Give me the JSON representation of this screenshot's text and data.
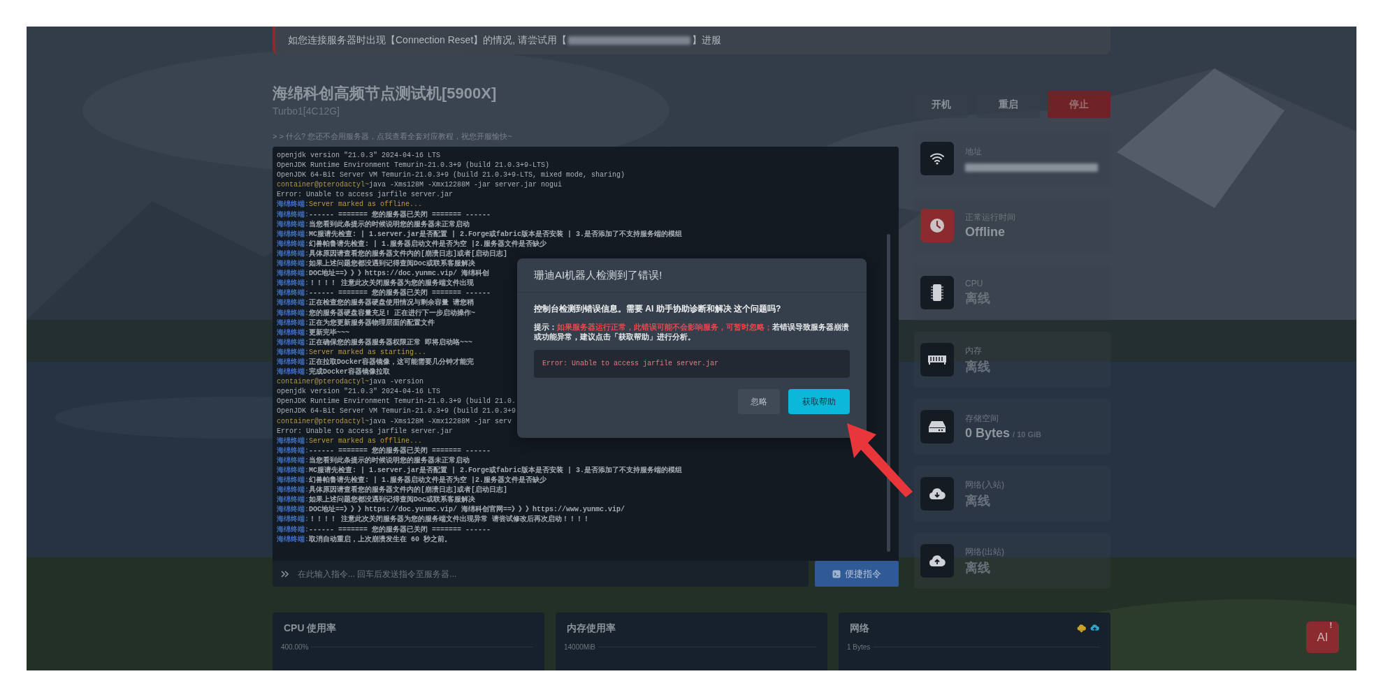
{
  "notice": {
    "before": "如您连接服务器时出现【Connection Reset】的情况, 请尝试用【",
    "after": "】进服",
    "redacted": true
  },
  "server": {
    "title": "海绵科创高频节点测试机[5900X]",
    "subtitle": "Turbo1[4C12G]",
    "hint": "> > 什么? 您还不会用服务器，点我查看全套对应教程，祝您开服愉快~"
  },
  "terminal": {
    "lines": [
      {
        "kind": "output",
        "text": "openjdk version \"21.0.3\" 2024-04-16 LTS"
      },
      {
        "kind": "output",
        "text": "OpenJDK Runtime Environment Temurin-21.0.3+9 (build 21.0.3+9-LTS)"
      },
      {
        "kind": "output",
        "text": "OpenJDK 64-Bit Server VM Temurin-21.0.3+9 (build 21.0.3+9-LTS, mixed mode, sharing)"
      },
      {
        "kind": "prompt",
        "prefix": "container@pterodactyl~",
        "text": "java -Xms128M -Xmx12288M -jar server.jar nogui"
      },
      {
        "kind": "output",
        "text": "Error: Unable to access jarfile server.jar"
      },
      {
        "kind": "status",
        "prefix": "海绵终端:",
        "text": "Server marked as offline..."
      },
      {
        "kind": "daemon",
        "prefix": "海绵终端:",
        "text": "------ ======= 您的服务器已关闭 ======= ------"
      },
      {
        "kind": "daemon",
        "prefix": "海绵终端:",
        "text": "当您看到此条提示的时候说明您的服务器未正常启动"
      },
      {
        "kind": "daemon",
        "prefix": "海绵终端:",
        "text": "MC服请先检查: | 1.server.jar是否配置 | 2.Forge或fabric版本是否安装 | 3.是否添加了不支持服务端的模组"
      },
      {
        "kind": "daemon",
        "prefix": "海绵终端:",
        "text": "幻兽帕鲁请先检查: | 1.服务器启动文件是否为空 |2.服务器文件是否缺少"
      },
      {
        "kind": "daemon",
        "prefix": "海绵终端:",
        "text": "具体原因请查看您的服务器文件内的[崩溃日志]或者[启动日志]"
      },
      {
        "kind": "daemon",
        "prefix": "海绵终端:",
        "text": "如果上述问题您都没遇到记得查阅Doc或联系客服解决"
      },
      {
        "kind": "daemon",
        "prefix": "海绵终端:",
        "text": "DOC地址==》》》https://doc.yunmc.vip/ 海绵科创"
      },
      {
        "kind": "daemon",
        "prefix": "海绵终端:",
        "text": "！！！！ 注意此次关闭服务器为您的服务端文件出现"
      },
      {
        "kind": "daemon",
        "prefix": "海绵终端:",
        "text": "------ ======= 您的服务器已关闭 ======= ------"
      },
      {
        "kind": "daemon",
        "prefix": "海绵终端:",
        "text": "正在检查您的服务器硬盘使用情况与剩余容量 请您稍"
      },
      {
        "kind": "daemon",
        "prefix": "海绵终端:",
        "text": "您的服务器硬盘容量充足! 正在进行下一步启动操作~"
      },
      {
        "kind": "daemon",
        "prefix": "海绵终端:",
        "text": "正在为您更新服务器物理层面的配置文件"
      },
      {
        "kind": "daemon",
        "prefix": "海绵终端:",
        "text": "更新完毕~~~"
      },
      {
        "kind": "daemon",
        "prefix": "海绵终端:",
        "text": "正在确保您的服务器服务器权限正常 即将启动咯~~~"
      },
      {
        "kind": "status",
        "prefix": "海绵终端:",
        "text": "Server marked as starting..."
      },
      {
        "kind": "daemon",
        "prefix": "海绵终端:",
        "text": "正在拉取Docker容器镜像，这可能需要几分钟才能完"
      },
      {
        "kind": "daemon",
        "prefix": "海绵终端:",
        "text": "完成Docker容器镜像拉取"
      },
      {
        "kind": "prompt",
        "prefix": "container@pterodactyl~",
        "text": "java -version"
      },
      {
        "kind": "output",
        "text": "openjdk version \"21.0.3\" 2024-04-16 LTS"
      },
      {
        "kind": "output",
        "text": "OpenJDK Runtime Environment Temurin-21.0.3+9 (build 21.0."
      },
      {
        "kind": "output",
        "text": "OpenJDK 64-Bit Server VM Temurin-21.0.3+9 (build 21.0.3+9"
      },
      {
        "kind": "prompt",
        "prefix": "container@pterodactyl~",
        "text": "java -Xms128M -Xmx12288M -jar serv"
      },
      {
        "kind": "output",
        "text": "Error: Unable to access jarfile server.jar"
      },
      {
        "kind": "status",
        "prefix": "海绵终端:",
        "text": "Server marked as offline..."
      },
      {
        "kind": "daemon",
        "prefix": "海绵终端:",
        "text": "------ ======= 您的服务器已关闭 ======= ------"
      },
      {
        "kind": "daemon",
        "prefix": "海绵终端:",
        "text": "当您看到此条提示的时候说明您的服务器未正常启动"
      },
      {
        "kind": "daemon",
        "prefix": "海绵终端:",
        "text": "MC服请先检查: | 1.server.jar是否配置 | 2.Forge或fabric版本是否安装 | 3.是否添加了不支持服务端的模组"
      },
      {
        "kind": "daemon",
        "prefix": "海绵终端:",
        "text": "幻兽帕鲁请先检查: | 1.服务器启动文件是否为空 |2.服务器文件是否缺少"
      },
      {
        "kind": "daemon",
        "prefix": "海绵终端:",
        "text": "具体原因请查看您的服务器文件内的[崩溃日志]或者[启动日志]"
      },
      {
        "kind": "daemon",
        "prefix": "海绵终端:",
        "text": "如果上述问题您都没遇到记得查阅Doc或联系客服解决"
      },
      {
        "kind": "daemon",
        "prefix": "海绵终端:",
        "text": "DOC地址==》》》https://doc.yunmc.vip/ 海绵科创官网==》》》https://www.yunmc.vip/"
      },
      {
        "kind": "daemon",
        "prefix": "海绵终端:",
        "text": "！！！！ 注意此次关闭服务器为您的服务端文件出现异常 请尝试修改后再次启动！！！！"
      },
      {
        "kind": "daemon",
        "prefix": "海绵终端:",
        "text": "------ ======= 您的服务器已关闭 ======= ------"
      },
      {
        "kind": "daemon",
        "prefix": "海绵终端:",
        "text": "取消自动重启，上次崩溃发生在 60 秒之前。"
      }
    ],
    "input": {
      "placeholder": "在此输入指令... 回车后发送指令至服务器..."
    },
    "quick_button": "便捷指令"
  },
  "dialog": {
    "title": "珊迪AI机器人检测到了错误!",
    "question": "控制台检测到错误信息。需要 AI 助手协助诊断和解决 这个问题吗?",
    "hint": "提示：**如果服务器运行正常，此错误可能不会影响服务，可暂时忽略；**若错误导致服务器崩溃或功能异常，建议点击「获取帮助」进行分析。",
    "error": "Error: Unable to access jarfile server.jar",
    "buttons": [
      {
        "label": "忽略",
        "kind": "secondary"
      },
      {
        "label": "获取帮助",
        "kind": "primary"
      }
    ]
  },
  "power_buttons": [
    {
      "label": "开机",
      "kind": "start"
    },
    {
      "label": "重启",
      "kind": "restart"
    },
    {
      "label": "停止",
      "kind": "stop"
    }
  ],
  "stats": [
    {
      "label": "地址",
      "redacted": true,
      "alert": false
    },
    {
      "label": "正常运行时间",
      "value": "Offline",
      "dim": false,
      "redacted": false,
      "alert": true
    },
    {
      "label": "CPU",
      "value": "离线",
      "dim": true,
      "redacted": false,
      "alert": false
    },
    {
      "label": "内存",
      "value": "离线",
      "dim": true,
      "redacted": false,
      "alert": false
    },
    {
      "label": "存储空间",
      "value": "0 Bytes",
      "total": "/ 10 GiB",
      "dim": false,
      "redacted": false,
      "alert": false
    },
    {
      "label": "网络(入站)",
      "value": "离线",
      "dim": true,
      "redacted": false,
      "alert": false
    },
    {
      "label": "网络(出站)",
      "value": "离线",
      "dim": true,
      "redacted": false,
      "alert": false
    }
  ],
  "charts": [
    {
      "title": "CPU 使用率",
      "tick": "400.00%",
      "kind": "usage"
    },
    {
      "title": "内存使用率",
      "tick": "14000MiB",
      "kind": "usage"
    },
    {
      "title": "网络",
      "tick": "1 Bytes",
      "kind": "network"
    }
  ],
  "ai_button": {
    "label": "AI",
    "badge": "!"
  }
}
